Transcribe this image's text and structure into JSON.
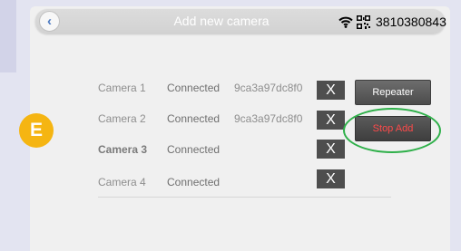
{
  "header": {
    "back_icon": "chevron-left-icon",
    "title": "Add new camera",
    "wifi_icon": "wifi-icon",
    "qr_icon": "qr-code-icon",
    "device_id": "3810380843"
  },
  "cameras": [
    {
      "label": "Camera 1",
      "status": "Connected",
      "mac": "9ca3a97dc8f0",
      "remove": "X"
    },
    {
      "label": "Camera 2",
      "status": "Connected",
      "mac": "9ca3a97dc8f0",
      "remove": "X"
    },
    {
      "label": "Camera 3",
      "status": "Connected",
      "mac": "",
      "remove": "X"
    },
    {
      "label": "Camera 4",
      "status": "Connected",
      "mac": "",
      "remove": "X"
    }
  ],
  "actions": {
    "repeater_label": "Repeater",
    "stop_add_label": "Stop Add"
  },
  "annotation": {
    "step_letter": "E",
    "ring_color": "#2fb04a",
    "badge_color": "#f5b512"
  },
  "colors": {
    "stop_text": "#ff4a4a",
    "back_arrow": "#4a78c0"
  }
}
